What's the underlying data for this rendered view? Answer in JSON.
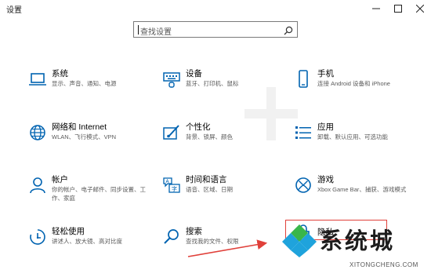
{
  "window": {
    "title": "设置",
    "buttons": [
      "minimize",
      "maximize",
      "close"
    ]
  },
  "search": {
    "placeholder": "查找设置",
    "icon": "search-icon"
  },
  "tiles": [
    {
      "id": "system",
      "title": "系统",
      "subtitle": "显示、声音、通知、电源",
      "icon": "laptop-icon"
    },
    {
      "id": "devices",
      "title": "设备",
      "subtitle": "蓝牙、打印机、鼠标",
      "icon": "keyboard-icon"
    },
    {
      "id": "phone",
      "title": "手机",
      "subtitle": "连接 Android 设备和 iPhone",
      "icon": "phone-icon"
    },
    {
      "id": "network",
      "title": "网络和 Internet",
      "subtitle": "WLAN、飞行模式、VPN",
      "icon": "globe-icon"
    },
    {
      "id": "personalization",
      "title": "个性化",
      "subtitle": "背景、锁屏、颜色",
      "icon": "paint-icon"
    },
    {
      "id": "apps",
      "title": "应用",
      "subtitle": "卸载、默认应用、可选功能",
      "icon": "apps-list-icon"
    },
    {
      "id": "accounts",
      "title": "帐户",
      "subtitle": "你的帐户、电子邮件、同步设置、工作、家庭",
      "icon": "person-icon"
    },
    {
      "id": "time-language",
      "title": "时间和语言",
      "subtitle": "语音、区域、日期",
      "icon": "time-language-icon"
    },
    {
      "id": "gaming",
      "title": "游戏",
      "subtitle": "Xbox Game Bar、捕获、游戏模式",
      "icon": "xbox-icon"
    },
    {
      "id": "ease-of-access",
      "title": "轻松使用",
      "subtitle": "讲述人、放大镜、高对比度",
      "icon": "ease-access-icon"
    },
    {
      "id": "search",
      "title": "搜索",
      "subtitle": "查找我的文件、权限",
      "icon": "magnifier-icon"
    },
    {
      "id": "privacy",
      "title": "隐私",
      "subtitle": "",
      "icon": "lock-icon"
    }
  ],
  "watermark": {
    "text_cn": "系统城",
    "text_en": "XITONGCHENG.COM"
  },
  "colors": {
    "accent": "#0063b1",
    "highlight": "#e0403a"
  }
}
